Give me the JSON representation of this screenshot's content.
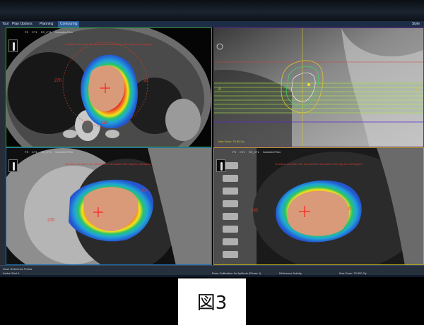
{
  "tabs": [
    "Plan Options",
    "Planning",
    "Contouring"
  ],
  "menu_left": "Tool",
  "style_label": "Style",
  "viewport_toolbar": {
    "item1": "FS",
    "item2": "CT1",
    "item3": "SS_CT1",
    "plan": "SubmitterPlan"
  },
  "warning_text": "Decision densities are not used for structures that may be overlapped",
  "viewports": {
    "axial": {
      "angle_left": "270",
      "angle_right": "90",
      "angle_bottom": "180"
    },
    "coronal_drr": {
      "max_dose": "Max Dose: 79.50 Gy",
      "ctrl_a": "A",
      "ctrl_b": "B"
    },
    "coronal": {
      "angle_right": "90",
      "angle_left": "270"
    },
    "sagittal": {
      "angle_left": "180",
      "angle_right": "0"
    }
  },
  "status": {
    "panel_title": "Dose Reference Points",
    "item1": "Active Shot 1",
    "item2": "Dose Calibration for Aptitude (Phase 1)",
    "item3": "Reference Activity",
    "item4": "Max Dose: 79.500 Gy"
  },
  "caption": "図3",
  "colors": {
    "accent_green": "#3aa03a",
    "accent_purple": "#6a2a8a",
    "accent_blue": "#1d6fb2",
    "accent_yellow": "#b6a51c",
    "dose_red": "#e0262c",
    "isocenter": "#ff2020"
  }
}
